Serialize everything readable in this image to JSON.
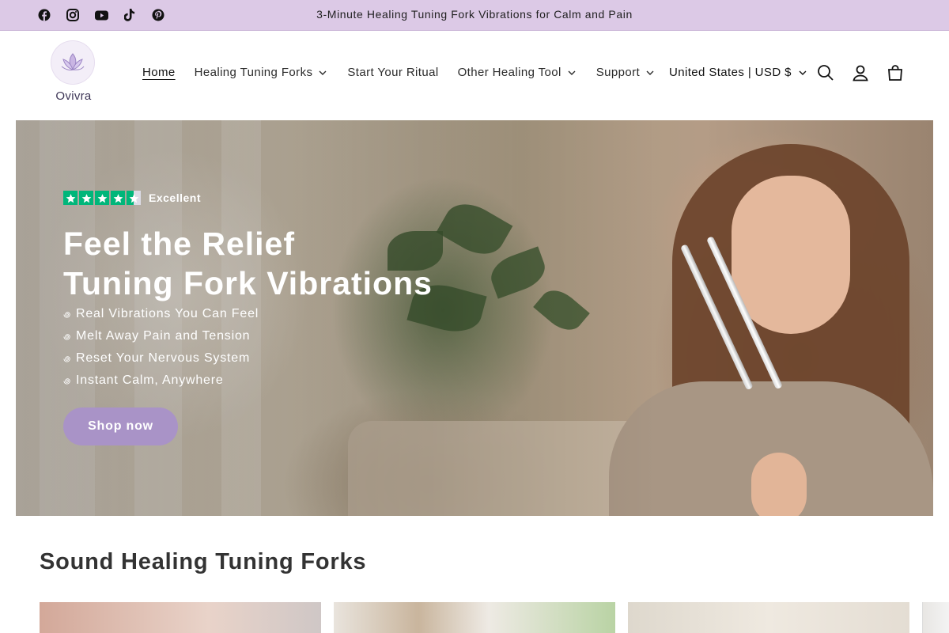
{
  "announcement": {
    "text": "3-Minute Healing Tuning Fork Vibrations for Calm and Pain",
    "social_icons": [
      "facebook-icon",
      "instagram-icon",
      "youtube-icon",
      "tiktok-icon",
      "pinterest-icon"
    ]
  },
  "header": {
    "logo_text": "Ovivra",
    "nav": [
      {
        "label": "Home",
        "active": true,
        "dropdown": false
      },
      {
        "label": "Healing Tuning Forks",
        "active": false,
        "dropdown": true
      },
      {
        "label": "Start Your Ritual",
        "active": false,
        "dropdown": false
      },
      {
        "label": "Other Healing Tool",
        "active": false,
        "dropdown": true
      },
      {
        "label": "Support",
        "active": false,
        "dropdown": true
      }
    ],
    "country_selector": "United States | USD $",
    "icons": [
      "search-icon",
      "account-icon",
      "cart-icon"
    ]
  },
  "hero": {
    "rating_label": "Excellent",
    "rating_stars": 4.5,
    "title_line1": "Feel the Relief",
    "title_line2": "Tuning Fork Vibrations",
    "bullets": [
      "Real Vibrations You Can Feel",
      "Melt Away Pain and Tension",
      "Reset Your Nervous System",
      "Instant Calm, Anywhere"
    ],
    "cta_label": "Shop now"
  },
  "collection": {
    "title": "Sound Healing Tuning Forks"
  },
  "colors": {
    "announcement_bg": "#dcc9e6",
    "button_bg": "#a993c7",
    "star_green": "#00b67a"
  }
}
